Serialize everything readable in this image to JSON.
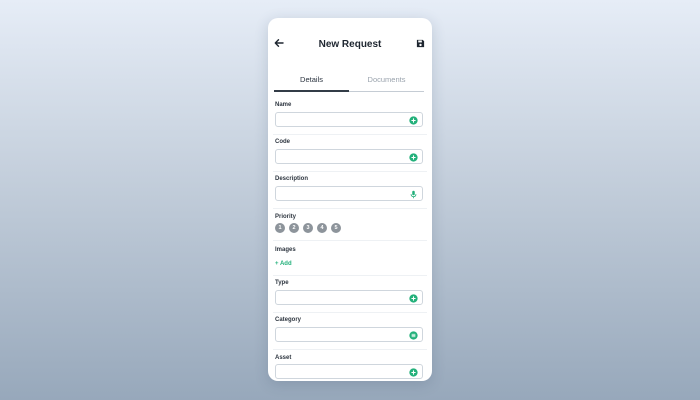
{
  "header": {
    "title": "New Request",
    "back_icon": "arrow-left-icon",
    "save_icon": "floppy-disk-icon"
  },
  "tabs": [
    {
      "label": "Details",
      "active": true
    },
    {
      "label": "Documents",
      "active": false
    }
  ],
  "fields": {
    "name": {
      "label": "Name",
      "value": "",
      "icon": "plus-circle-icon"
    },
    "code": {
      "label": "Code",
      "value": "",
      "icon": "plus-circle-icon"
    },
    "description": {
      "label": "Description",
      "value": "",
      "icon": "microphone-icon"
    },
    "type": {
      "label": "Type",
      "value": "",
      "icon": "plus-circle-icon"
    },
    "category": {
      "label": "Category",
      "value": "",
      "icon": "list-circle-icon"
    },
    "asset": {
      "label": "Asset",
      "value": "",
      "icon": "plus-circle-icon"
    }
  },
  "priority": {
    "label": "Priority",
    "options": [
      "1",
      "2",
      "3",
      "4",
      "5"
    ]
  },
  "images": {
    "label": "Images",
    "add_label": "+ Add"
  },
  "colors": {
    "accent": "#22b07a",
    "priority_circle": "#8d949b",
    "text_dark": "#1e2630"
  }
}
